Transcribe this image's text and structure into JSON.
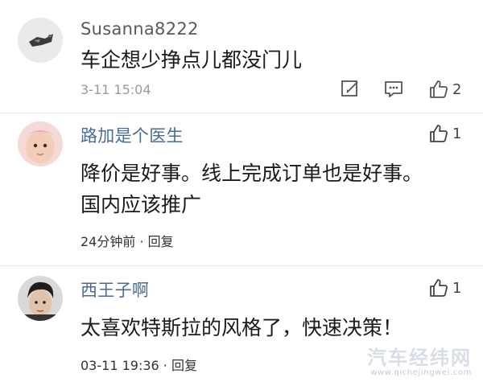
{
  "comments": [
    {
      "username": "Susanna8222",
      "text_lines": [
        "车企想少挣点儿都没门儿"
      ],
      "meta": "3-11 15:04",
      "actions": {
        "edit_icon": "edit-icon",
        "reply_icon": "comment-icon",
        "likes": "2"
      }
    },
    {
      "username": "路加是个医生",
      "text_lines": [
        "降价是好事。线上完成订单也是好事。",
        "国内应该推广"
      ],
      "meta": "24分钟前 · 回复",
      "actions": {
        "likes": "1"
      }
    },
    {
      "username": "西王子啊",
      "text_lines": [
        "太喜欢特斯拉的风格了，快速决策！"
      ],
      "meta": "03-11 19:36 · 回复",
      "actions": {
        "likes": "1"
      }
    }
  ],
  "watermark": {
    "main": "汽车经纬网",
    "url": "www.qichejingwei.com"
  },
  "colors": {
    "username_blue": "#4a6b94",
    "meta_gray": "#9a9a9a",
    "divider": "#e6e6e6"
  }
}
